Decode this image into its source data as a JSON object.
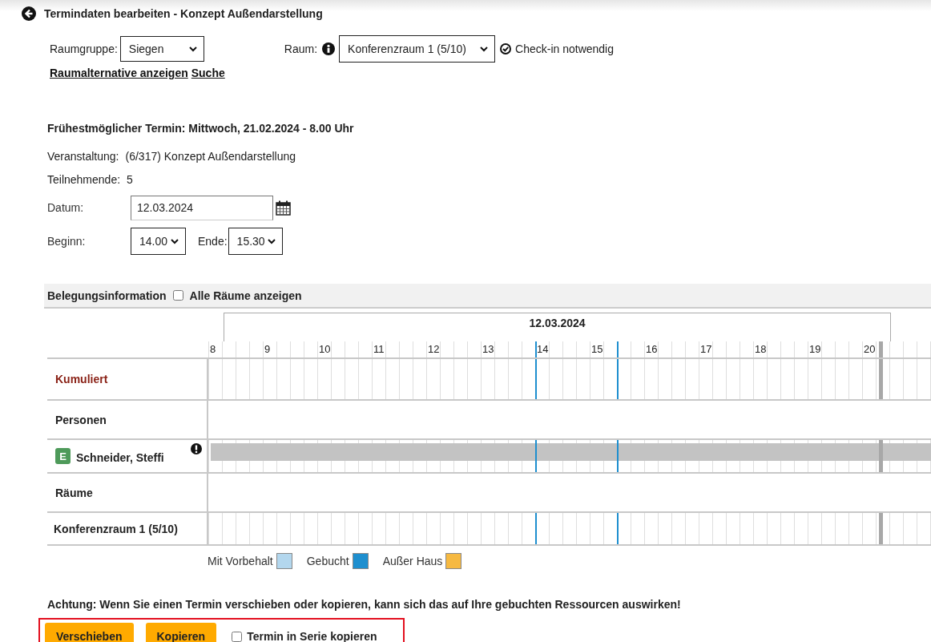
{
  "header": {
    "title": "Termindaten bearbeiten - Konzept Außendarstellung"
  },
  "room": {
    "group_label": "Raumgruppe:",
    "group_value": "Siegen",
    "room_label": "Raum:",
    "room_value": "Konferenzraum 1 (5/10)",
    "checkin_required": true,
    "checkin_text": "Check-in notwendig"
  },
  "links": [
    "Raumalternative anzeigen",
    "Suche"
  ],
  "earliest": "Frühestmöglicher Termin: Mittwoch, 21.02.2024 - 8.00 Uhr",
  "details": [
    {
      "label": "Veranstaltung:",
      "value": "(6/317) Konzept Außendarstellung"
    },
    {
      "label": "Teilnehmende:",
      "value": "5"
    }
  ],
  "date": {
    "label": "Datum:",
    "value": "12.03.2024"
  },
  "time": {
    "start_label": "Beginn:",
    "start": "14.00",
    "end_label": "Ende:",
    "end": "15.30"
  },
  "occupancy": {
    "title": "Belegungsinformation",
    "show_all_label": "Alle Räume anzeigen",
    "show_all": false,
    "date": "12.03.2024",
    "hours": [
      "8",
      "9",
      "10",
      "11",
      "12",
      "13",
      "14",
      "15",
      "16",
      "17",
      "18",
      "19",
      "20"
    ],
    "rows": [
      {
        "kind": "summary",
        "label": "Kumuliert"
      },
      {
        "kind": "section",
        "label": "Personen"
      },
      {
        "kind": "person",
        "badge": "E",
        "label": "Schneider, Steffi",
        "warning": true,
        "blocked": true
      },
      {
        "kind": "section",
        "label": "Räume"
      },
      {
        "kind": "resource",
        "label": "Konferenzraum 1 (5/10)"
      }
    ]
  },
  "legend": [
    {
      "label": "Mit Vorbehalt",
      "color": "#b3d7ee"
    },
    {
      "label": "Gebucht",
      "color": "#1e8fcf"
    },
    {
      "label": "Außer Haus",
      "color": "#f6b941"
    }
  ],
  "notice": "Achtung: Wenn Sie einen Termin verschieben oder kopieren, kann sich das auf Ihre gebuchten Ressourcen auswirken!",
  "actions": {
    "buttons": [
      "Verschieben",
      "Kopieren"
    ],
    "series_label": "Termin in Serie kopieren",
    "series_copy": false
  }
}
